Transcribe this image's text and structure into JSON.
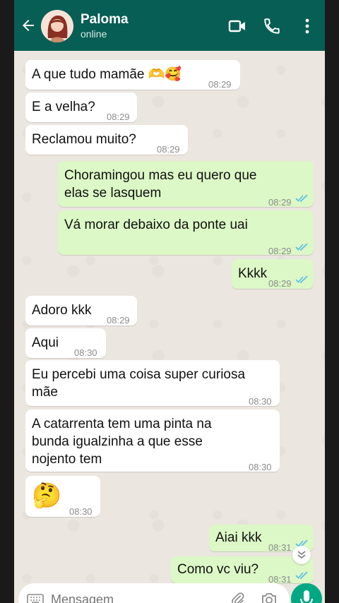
{
  "header": {
    "contact_name": "Paloma",
    "contact_status": "online",
    "header_color": "#075e54"
  },
  "messages": [
    {
      "dir": "in",
      "text": "A que tudo mamãe 🫶🥰",
      "time": "08:29"
    },
    {
      "dir": "in",
      "text": "E a velha?",
      "time": "08:29"
    },
    {
      "dir": "in",
      "text": "Reclamou muito?",
      "time": "08:29"
    },
    {
      "dir": "out",
      "text": "Choramingou mas eu quero que\nelas se lasquem",
      "time": "08:29",
      "read": true
    },
    {
      "dir": "out",
      "text": "Vá morar debaixo da ponte uai",
      "time": "08:29",
      "read": true
    },
    {
      "dir": "out",
      "text": "Kkkk",
      "time": "08:29",
      "read": true
    },
    {
      "dir": "in",
      "text": "Adoro kkk",
      "time": "08:29"
    },
    {
      "dir": "in",
      "text": "Aqui",
      "time": "08:30"
    },
    {
      "dir": "in",
      "text": "Eu percebi uma coisa super curiosa\nmãe",
      "time": "08:30"
    },
    {
      "dir": "in",
      "text": "A catarrenta tem uma pinta na\nbunda igualzinha a que esse\nnojento tem",
      "time": "08:30"
    },
    {
      "dir": "in",
      "text": "🤔",
      "time": "08:30"
    },
    {
      "dir": "out",
      "text": "Aiai kkk",
      "time": "08:31",
      "read": true
    },
    {
      "dir": "out",
      "text": "Como vc viu?",
      "time": "08:31",
      "read": true
    }
  ],
  "composer": {
    "placeholder": "Mensagem"
  },
  "colors": {
    "incoming_bubble": "#ffffff",
    "outgoing_bubble": "#dcf8c6",
    "read_ticks": "#53bdeb",
    "send_button": "#00a884"
  },
  "icons": {
    "back": "arrow-left-icon",
    "video": "video-call-icon",
    "call": "phone-icon",
    "menu": "more-vert-icon",
    "emoji": "keyboard-icon",
    "attach": "paperclip-icon",
    "camera": "camera-icon",
    "mic": "microphone-icon",
    "scroll": "double-chevron-down-icon"
  }
}
